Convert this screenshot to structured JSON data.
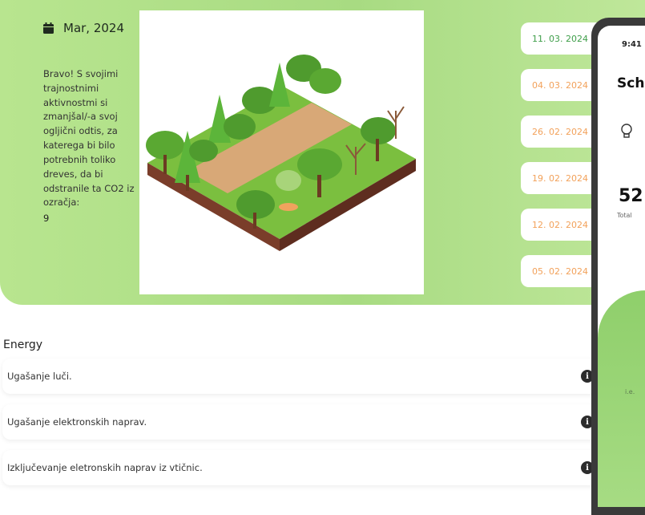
{
  "hero": {
    "month": "Mar, 2024",
    "message": "Bravo! S svojimi trajnostnimi aktivnostmi si zmanjšal/-a svoj ogljični odtis, za katerega bi bilo potrebnih toliko dreves, da bi odstranile ta CO2 iz ozračja:",
    "tree_count": "9",
    "illustration": "isometric-forest-path"
  },
  "dates": [
    {
      "label": "11. 03. 2024",
      "active": true
    },
    {
      "label": "04. 03. 2024",
      "active": false
    },
    {
      "label": "26. 02. 2024",
      "active": false
    },
    {
      "label": "19. 02. 2024",
      "active": false
    },
    {
      "label": "12. 02. 2024",
      "active": false
    },
    {
      "label": "05. 02. 2024",
      "active": false
    }
  ],
  "section": {
    "title": "Energy",
    "tasks": [
      {
        "label": "Ugašanje luči.",
        "icon": "info-icon"
      },
      {
        "label": "Ugašanje elektronskih naprav.",
        "icon": "info-icon"
      },
      {
        "label": "Izključevanje eletronskih naprav iz vtičnic.",
        "icon": "info-icon"
      }
    ]
  },
  "phone": {
    "time": "9:41",
    "title": "Sch",
    "value": "52",
    "total_label": "Total",
    "ie_label": "i.e."
  },
  "colors": {
    "hero_green": "#b8e58f",
    "active_date": "#3f9e4a",
    "inactive_date": "#f2a15a",
    "pill_orange": "#f3a45a"
  }
}
